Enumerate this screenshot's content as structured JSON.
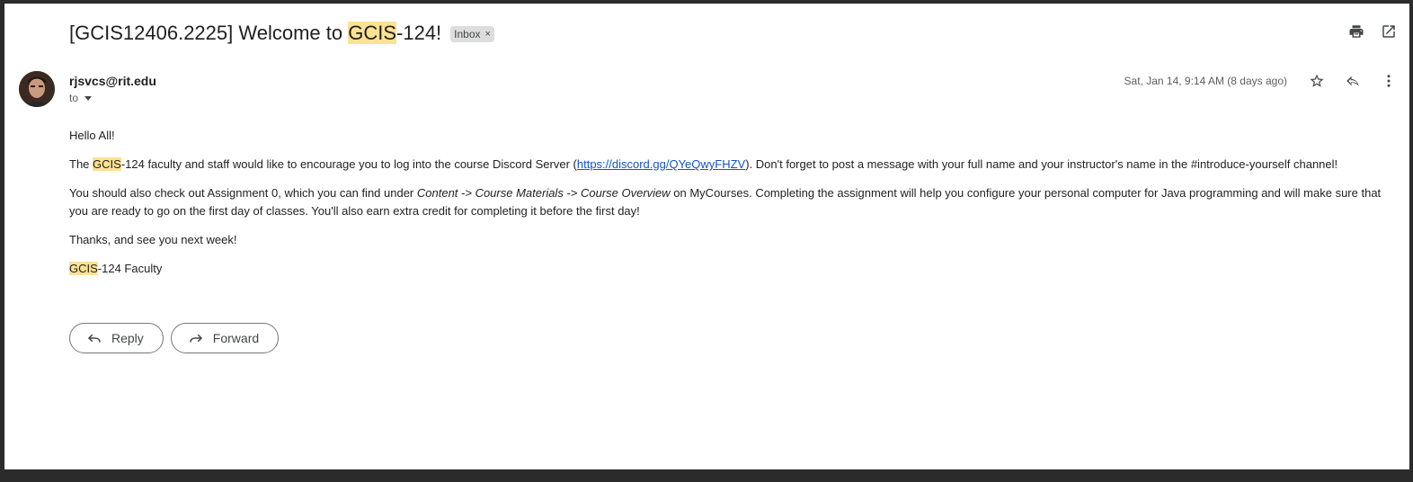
{
  "email": {
    "subject_prefix": "[GCIS12406.2225] Welcome to ",
    "subject_highlight": "GCIS",
    "subject_suffix": "-124!",
    "label": "Inbox",
    "label_close": "×",
    "sender": "rjsvcs@rit.edu",
    "to_label": "to",
    "date": "Sat, Jan 14, 9:14 AM (8 days ago)"
  },
  "icons": {
    "print": "print-icon",
    "open_new_window": "open-in-new-window-icon",
    "star": "star-icon",
    "reply": "reply-icon",
    "more": "more-vertical-icon",
    "forward": "forward-icon"
  },
  "body": {
    "greeting": "Hello All!",
    "p1_hl": "GCIS",
    "p1_a": "-124 faculty and staff would like to encourage you to log into the course Discord Server (",
    "p1_link": "https://discord.gg/QYeQwyFHZV",
    "p1_b": "). Don't forget to post a message with your full name and your instructor's name in the #introduce-yourself channel!",
    "p2_a": "You should also check out Assignment 0, which you can find under ",
    "p2_italic": "Content -> Course Materials -> Course Overview",
    "p2_b": " on MyCourses. Completing the assignment will help you configure your personal computer for Java programming and will make sure that you are ready to go on the first day of classes. You'll also earn extra credit for completing it before the first day!",
    "thanks": "Thanks, and see you next week!",
    "sig_hl": "GCIS",
    "sig_rest": "-124 Faculty"
  },
  "actions": {
    "reply_label": "Reply",
    "forward_label": "Forward"
  },
  "colors": {
    "highlight": "#fde293",
    "link": "#1155cc",
    "chip_bg": "#dddddd"
  }
}
